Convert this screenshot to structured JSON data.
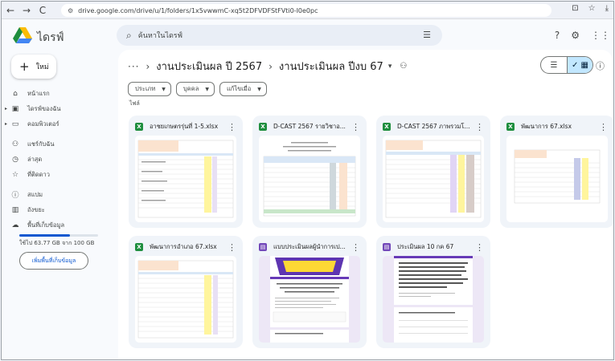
{
  "browser": {
    "back": "←",
    "forward": "→",
    "reload": "C",
    "url": "drive.google.com/drive/u/1/folders/1x5vwwmC-xq5t2DFVDFStFVti0-I0e0pc",
    "icons": [
      "install-app-icon",
      "star-icon",
      "download-icon"
    ]
  },
  "app": {
    "title": "ไดรฟ์",
    "search_placeholder": "ค้นหาในไดรฟ์"
  },
  "sidebar": {
    "new_label": "ใหม่",
    "items": [
      {
        "label": "หน้าแรก",
        "icon": "home-icon"
      },
      {
        "label": "ไดรฟ์ของฉัน",
        "icon": "my-drive-icon"
      },
      {
        "label": "คอมพิวเตอร์",
        "icon": "computer-icon"
      },
      {
        "label": "แชร์กับฉัน",
        "icon": "shared-icon"
      },
      {
        "label": "ล่าสุด",
        "icon": "recent-icon"
      },
      {
        "label": "ที่ติดดาว",
        "icon": "starred-icon"
      },
      {
        "label": "สแปม",
        "icon": "spam-icon"
      },
      {
        "label": "ถังขยะ",
        "icon": "trash-icon"
      },
      {
        "label": "พื้นที่เก็บข้อมูล",
        "icon": "storage-icon"
      }
    ],
    "storage_used_fraction": 0.64,
    "storage_text": "ใช้ไป 63.77 GB จาก 100 GB",
    "storage_button": "เพิ่มพื้นที่เก็บข้อมูล"
  },
  "breadcrumb": {
    "more": "···",
    "parent": "งานประเมินผล ปี 2567",
    "current": "งานประเมินผล ปีงบ 67"
  },
  "filters": {
    "chips": [
      "ประเภท",
      "บุคคล",
      "แก้ไขเมื่อ"
    ],
    "section_label": "ไฟล์"
  },
  "files": [
    {
      "name": "อาชยเกษตรรุ่นที่ 1-5.xlsx",
      "type": "X"
    },
    {
      "name": "D-CAST 2567 รายวิชาอ...",
      "type": "X"
    },
    {
      "name": "D-CAST 2567 ภาพรวมโ...",
      "type": "X"
    },
    {
      "name": "พัฒนาการ 67.xlsx",
      "type": "X"
    },
    {
      "name": "พัฒนาการอำเภอ 67.xlsx",
      "type": "X"
    },
    {
      "name": "แบบประเมินผลผู้นำการเป...",
      "type": "▤"
    },
    {
      "name": "ประเมินผล 10 กค 67",
      "type": "▤"
    }
  ]
}
